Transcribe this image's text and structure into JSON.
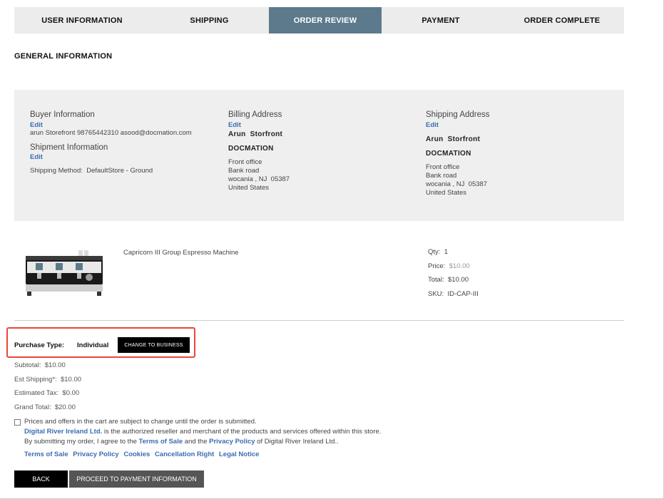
{
  "steps": [
    {
      "label": "USER INFORMATION",
      "active": false
    },
    {
      "label": "SHIPPING",
      "active": false
    },
    {
      "label": "ORDER REVIEW",
      "active": true
    },
    {
      "label": "PAYMENT",
      "active": false
    },
    {
      "label": "ORDER COMPLETE",
      "active": false
    }
  ],
  "general": {
    "title": "GENERAL INFORMATION"
  },
  "buyer": {
    "heading": "Buyer Information",
    "edit": "Edit",
    "details": "arun Storefront 98765442310 asood@docmation.com"
  },
  "shipment": {
    "heading": "Shipment Information",
    "edit": "Edit",
    "method_label": "Shipping Method:",
    "method_value": "DefaultStore - Ground"
  },
  "billing": {
    "heading": "Billing Address",
    "edit": "Edit",
    "name": "Arun  Storfront",
    "company": "DOCMATION",
    "lines": [
      "Front office",
      "Bank road",
      "wocania , NJ  05387",
      "United States"
    ]
  },
  "shipping_address": {
    "heading": "Shipping Address",
    "edit": "Edit",
    "name": "Arun  Storfront",
    "company": "DOCMATION",
    "lines": [
      "Front office",
      "Bank road",
      "wocania , NJ  05387",
      "United States"
    ]
  },
  "product": {
    "name": "Capricorn III Group Espresso Machine",
    "qty_label": "Qty:",
    "qty": "1",
    "price_label": "Price:",
    "price": "$10.00",
    "total_label": "Total:",
    "total": "$10.00",
    "sku_label": "SKU:",
    "sku": "ID-CAP-III"
  },
  "purchase": {
    "label": "Purchase Type:",
    "value": "Individual",
    "button": "CHANGE TO BUSINESS",
    "highlight_color": "#e8483a"
  },
  "totals": {
    "subtotal": "Subtotal:  $10.00",
    "shipping": "Est Shipping*:  $10.00",
    "tax": "Estimated Tax:  $0.00",
    "grand": "Grand Total:  $20.00"
  },
  "terms": {
    "line1": "Prices and offers in the cart are subject to change until the order is submitted.",
    "reseller": "Digital River Ireland Ltd.",
    "line2_rest": " is the authorized reseller and merchant of the products and services offered within this store.",
    "line3_pre": "By submitting my order, I agree to the ",
    "terms_link": "Terms of Sale",
    "line3_mid": " and the ",
    "privacy_link": "Privacy Policy",
    "line3_post": " of Digital River Ireland Ltd..",
    "links": [
      "Terms of Sale",
      "Privacy Policy",
      "Cookies",
      "Cancellation Right",
      "Legal Notice"
    ]
  },
  "buttons": {
    "back": "BACK",
    "proceed": "PROCEED TO PAYMENT INFORMATION"
  },
  "colors": {
    "active_step": "#5c7a8c",
    "link": "#3b6cb4"
  }
}
